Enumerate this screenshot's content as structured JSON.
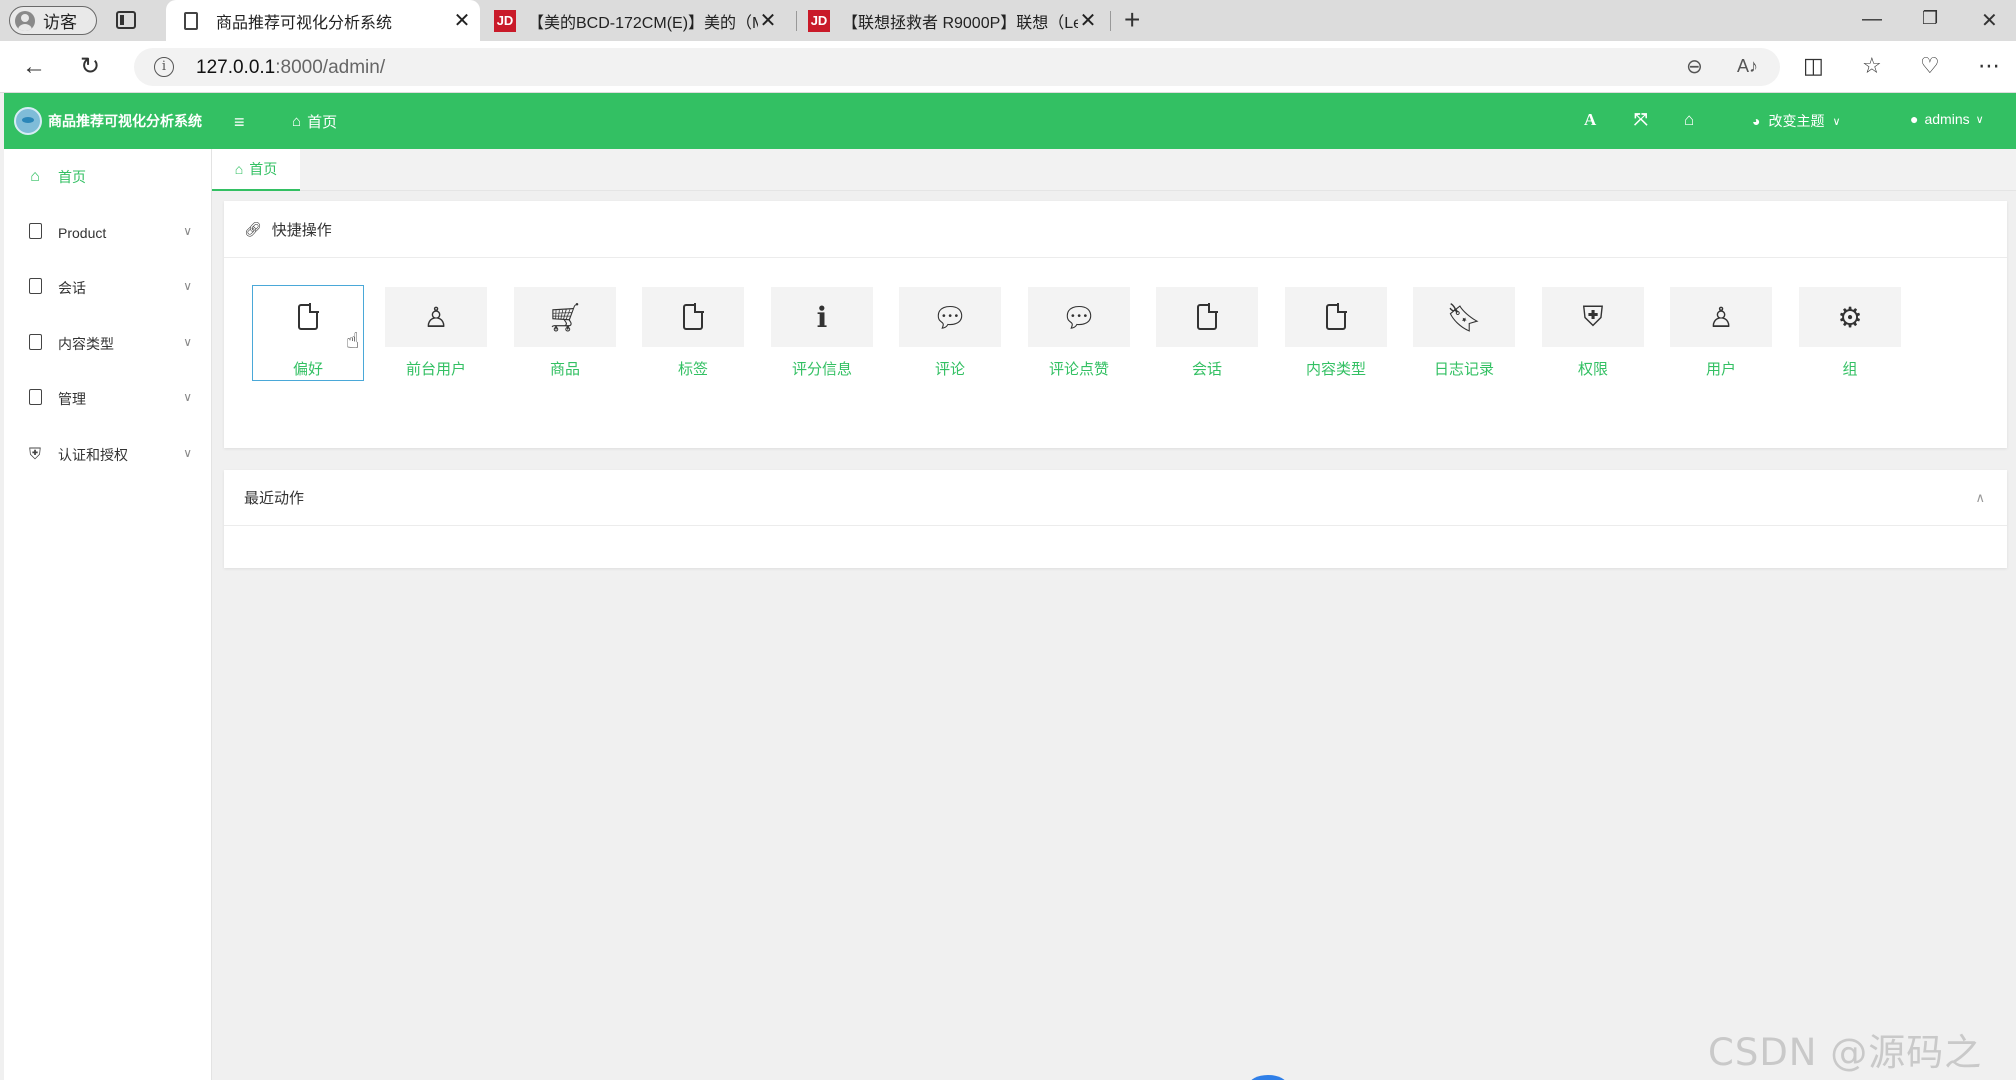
{
  "browser": {
    "guest_label": "访客",
    "tabs": [
      {
        "title": "商品推荐可视化分析系统",
        "active": true
      },
      {
        "title": "【美的BCD-172CM(E)】美的（M",
        "active": false
      },
      {
        "title": "【联想拯救者 R9000P】联想（Le",
        "active": false
      }
    ],
    "jd_badge": "JD",
    "close_glyph": "✕",
    "new_tab_glyph": "+",
    "url_host": "127.0.0.1",
    "url_rest": ":8000/admin/"
  },
  "app": {
    "title": "商品推荐可视化分析系统",
    "header_home": "首页",
    "theme_label": "改变主题",
    "user_label": "admins",
    "accent_color": "#33c063"
  },
  "sidebar": {
    "items": [
      {
        "label": "首页",
        "icon": "home-icon",
        "active": true
      },
      {
        "label": "Product",
        "icon": "file-icon"
      },
      {
        "label": "会话",
        "icon": "file-icon"
      },
      {
        "label": "内容类型",
        "icon": "file-icon"
      },
      {
        "label": "管理",
        "icon": "file-icon"
      },
      {
        "label": "认证和授权",
        "icon": "shield-icon"
      }
    ]
  },
  "page_tab": {
    "label": "首页"
  },
  "quick_actions": {
    "title": "快捷操作",
    "items": [
      {
        "label": "偏好",
        "icon": "file-icon"
      },
      {
        "label": "前台用户",
        "icon": "user-icon"
      },
      {
        "label": "商品",
        "icon": "cart-icon"
      },
      {
        "label": "标签",
        "icon": "file-icon"
      },
      {
        "label": "评分信息",
        "icon": "info-icon"
      },
      {
        "label": "评论",
        "icon": "comments-icon"
      },
      {
        "label": "评论点赞",
        "icon": "comments-icon"
      },
      {
        "label": "会话",
        "icon": "file-icon"
      },
      {
        "label": "内容类型",
        "icon": "file-icon"
      },
      {
        "label": "日志记录",
        "icon": "bookmark-icon"
      },
      {
        "label": "权限",
        "icon": "shield-icon"
      },
      {
        "label": "用户",
        "icon": "user-icon"
      },
      {
        "label": "组",
        "icon": "users-cog-icon"
      }
    ]
  },
  "recent_actions": {
    "title": "最近动作"
  },
  "watermark": "CSDN @源码之家"
}
